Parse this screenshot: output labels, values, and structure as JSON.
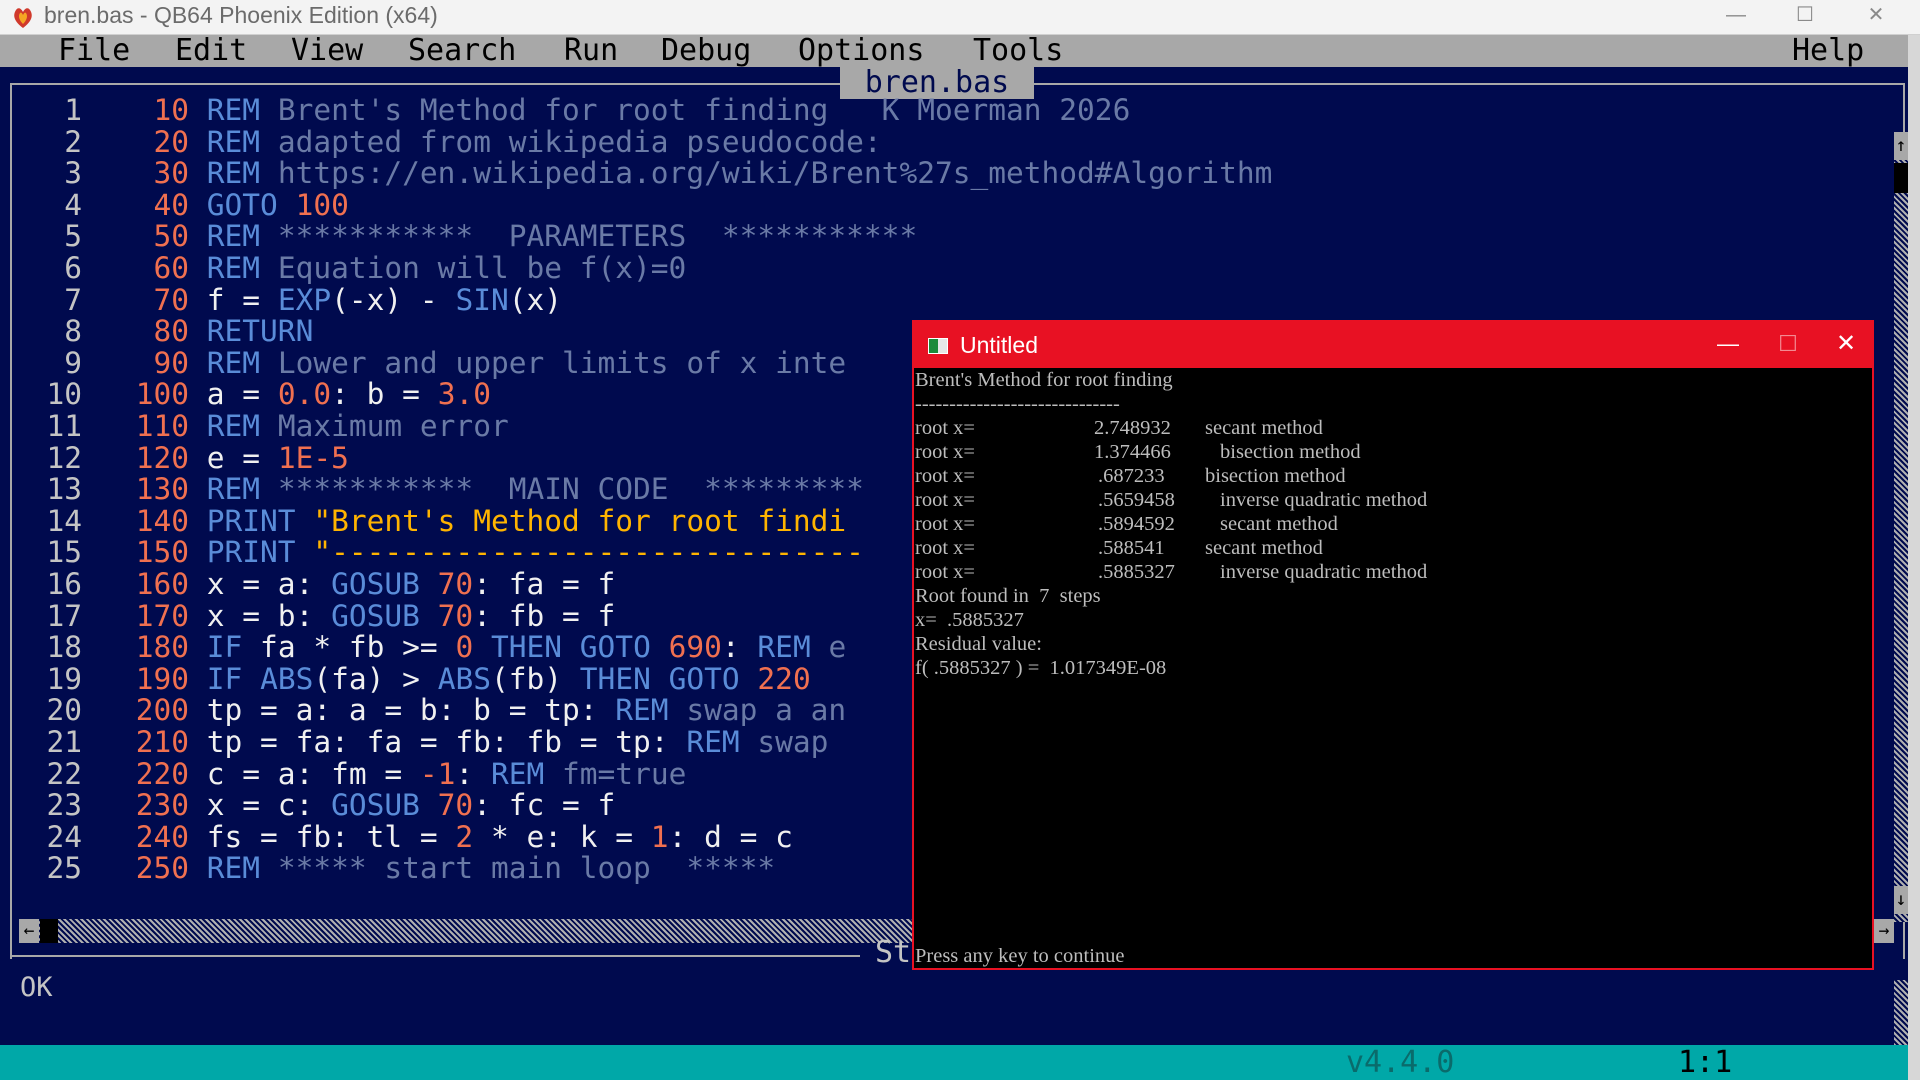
{
  "app": {
    "title": "bren.bas - QB64 Phoenix Edition (x64)",
    "controls": {
      "minimize": "—",
      "maximize": "☐",
      "close": "✕"
    }
  },
  "menu": [
    "File",
    "Edit",
    "View",
    "Search",
    "Run",
    "Debug",
    "Options",
    "Tools"
  ],
  "help_label": "Help",
  "editor": {
    "tab_label": "bren.bas",
    "lines": [
      {
        "n": "1",
        "bn": "10",
        "tokens": [
          [
            "REM",
            "kw"
          ],
          [
            " Brent's Method for root finding   K Moerman 2026",
            "rem"
          ]
        ]
      },
      {
        "n": "2",
        "bn": "20",
        "tokens": [
          [
            "REM",
            "kw"
          ],
          [
            " adapted from wikipedia pseudocode:",
            "rem"
          ]
        ]
      },
      {
        "n": "3",
        "bn": "30",
        "tokens": [
          [
            "REM",
            "kw"
          ],
          [
            " https://en.wikipedia.org/wiki/Brent%27s_method#Algorithm",
            "rem"
          ]
        ]
      },
      {
        "n": "4",
        "bn": "40",
        "tokens": [
          [
            "GOTO",
            "kw"
          ],
          [
            " ",
            "id"
          ],
          [
            "100",
            "num"
          ]
        ]
      },
      {
        "n": "5",
        "bn": "50",
        "tokens": [
          [
            "REM",
            "kw"
          ],
          [
            " ***********  PARAMETERS  ***********",
            "rem"
          ]
        ]
      },
      {
        "n": "6",
        "bn": "60",
        "tokens": [
          [
            "REM",
            "kw"
          ],
          [
            " Equation will be f(x)=0",
            "rem"
          ]
        ]
      },
      {
        "n": "7",
        "bn": "70",
        "tokens": [
          [
            "f = ",
            "id"
          ],
          [
            "EXP",
            "kw"
          ],
          [
            "(-x) - ",
            "id"
          ],
          [
            "SIN",
            "kw"
          ],
          [
            "(x)",
            "id"
          ]
        ]
      },
      {
        "n": "8",
        "bn": "80",
        "tokens": [
          [
            "RETURN",
            "kw"
          ]
        ]
      },
      {
        "n": "9",
        "bn": "90",
        "tokens": [
          [
            "REM",
            "kw"
          ],
          [
            " Lower and upper limits of x inte",
            "rem"
          ]
        ]
      },
      {
        "n": "10",
        "bn": "100",
        "tokens": [
          [
            "a = ",
            "id"
          ],
          [
            "0.0",
            "num"
          ],
          [
            ": b = ",
            "id"
          ],
          [
            "3.0",
            "num"
          ]
        ]
      },
      {
        "n": "11",
        "bn": "110",
        "tokens": [
          [
            "REM",
            "kw"
          ],
          [
            " Maximum error",
            "rem"
          ]
        ]
      },
      {
        "n": "12",
        "bn": "120",
        "tokens": [
          [
            "e = ",
            "id"
          ],
          [
            "1E-5",
            "num"
          ]
        ]
      },
      {
        "n": "13",
        "bn": "130",
        "tokens": [
          [
            "REM",
            "kw"
          ],
          [
            " ***********  MAIN CODE  *********",
            "rem"
          ]
        ]
      },
      {
        "n": "14",
        "bn": "140",
        "tokens": [
          [
            "PRINT",
            "kw"
          ],
          [
            " ",
            "id"
          ],
          [
            "\"Brent's Method for root findi",
            "str"
          ]
        ]
      },
      {
        "n": "15",
        "bn": "150",
        "tokens": [
          [
            "PRINT",
            "kw"
          ],
          [
            " ",
            "id"
          ],
          [
            "\"------------------------------",
            "str"
          ]
        ]
      },
      {
        "n": "16",
        "bn": "160",
        "tokens": [
          [
            "x = a: ",
            "id"
          ],
          [
            "GOSUB",
            "kw"
          ],
          [
            " ",
            "id"
          ],
          [
            "70",
            "num"
          ],
          [
            ": fa = f",
            "id"
          ]
        ]
      },
      {
        "n": "17",
        "bn": "170",
        "tokens": [
          [
            "x = b: ",
            "id"
          ],
          [
            "GOSUB",
            "kw"
          ],
          [
            " ",
            "id"
          ],
          [
            "70",
            "num"
          ],
          [
            ": fb = f",
            "id"
          ]
        ]
      },
      {
        "n": "18",
        "bn": "180",
        "tokens": [
          [
            "IF",
            "kw"
          ],
          [
            " fa * fb >= ",
            "id"
          ],
          [
            "0",
            "num"
          ],
          [
            " ",
            "id"
          ],
          [
            "THEN",
            "kw"
          ],
          [
            " ",
            "id"
          ],
          [
            "GOTO",
            "kw"
          ],
          [
            " ",
            "id"
          ],
          [
            "690",
            "num"
          ],
          [
            ": ",
            "id"
          ],
          [
            "REM",
            "kw"
          ],
          [
            " e",
            "rem"
          ]
        ]
      },
      {
        "n": "19",
        "bn": "190",
        "tokens": [
          [
            "IF",
            "kw"
          ],
          [
            " ",
            "id"
          ],
          [
            "ABS",
            "kw"
          ],
          [
            "(fa) > ",
            "id"
          ],
          [
            "ABS",
            "kw"
          ],
          [
            "(fb) ",
            "id"
          ],
          [
            "THEN",
            "kw"
          ],
          [
            " ",
            "id"
          ],
          [
            "GOTO",
            "kw"
          ],
          [
            " ",
            "id"
          ],
          [
            "220",
            "num"
          ]
        ]
      },
      {
        "n": "20",
        "bn": "200",
        "tokens": [
          [
            "tp = a: a = b: b = tp: ",
            "id"
          ],
          [
            "REM",
            "kw"
          ],
          [
            " swap a an",
            "rem"
          ]
        ]
      },
      {
        "n": "21",
        "bn": "210",
        "tokens": [
          [
            "tp = fa: fa = fb: fb = tp: ",
            "id"
          ],
          [
            "REM",
            "kw"
          ],
          [
            " swap",
            "rem"
          ]
        ]
      },
      {
        "n": "22",
        "bn": "220",
        "tokens": [
          [
            "c = a: fm = ",
            "id"
          ],
          [
            "-1",
            "num"
          ],
          [
            ": ",
            "id"
          ],
          [
            "REM",
            "kw"
          ],
          [
            " fm=true",
            "rem"
          ]
        ]
      },
      {
        "n": "23",
        "bn": "230",
        "tokens": [
          [
            "x = c: ",
            "id"
          ],
          [
            "GOSUB",
            "kw"
          ],
          [
            " ",
            "id"
          ],
          [
            "70",
            "num"
          ],
          [
            ": fc = f",
            "id"
          ]
        ]
      },
      {
        "n": "24",
        "bn": "240",
        "tokens": [
          [
            "fs = fb: tl = ",
            "id"
          ],
          [
            "2",
            "num"
          ],
          [
            " * e: k = ",
            "id"
          ],
          [
            "1",
            "num"
          ],
          [
            ": d = c",
            "id"
          ]
        ]
      },
      {
        "n": "25",
        "bn": "250",
        "tokens": [
          [
            "REM",
            "kw"
          ],
          [
            " ***** start main loop  *****",
            "rem"
          ]
        ]
      }
    ]
  },
  "scroll": {
    "up": "↑",
    "down": "↓",
    "left": "←",
    "right": "→"
  },
  "status_panel": {
    "title": "St",
    "text": "OK"
  },
  "statusbar": {
    "version": "v4.4.0",
    "cursor": "1:1"
  },
  "output_window": {
    "title": "Untitled",
    "controls": {
      "minimize": "—",
      "maximize": "☐",
      "close": "✕"
    },
    "heading": "Brent's Method for root finding",
    "separator": "------------------------------",
    "roots": [
      {
        "label": "root x=",
        "value": "2.748932",
        "method": "secant method"
      },
      {
        "label": "root x=",
        "value": "1.374466",
        "method": "bisection method"
      },
      {
        "label": "root x=",
        "value": ".687233",
        "method": "bisection method"
      },
      {
        "label": "root x=",
        "value": ".5659458",
        "method": "inverse quadratic method"
      },
      {
        "label": "root x=",
        "value": ".5894592",
        "method": "secant method"
      },
      {
        "label": "root x=",
        "value": ".588541",
        "method": "secant method"
      },
      {
        "label": "root x=",
        "value": ".5885327",
        "method": "inverse quadratic method"
      }
    ],
    "steps_line": "Root found in  7  steps",
    "x_line": "x=  .5885327",
    "residual_label": "Residual value:",
    "residual_line": "f( .5885327 ) =  1.017349E-08",
    "prompt": "Press any key to continue"
  },
  "colors": {
    "ide_bg": "#000a4e",
    "menubar": "#a8a8a8",
    "statusbar": "#00a8a8",
    "keyword": "#5a8cd8",
    "number": "#f07050",
    "string": "#ffb400",
    "accent_red": "#e81123"
  }
}
